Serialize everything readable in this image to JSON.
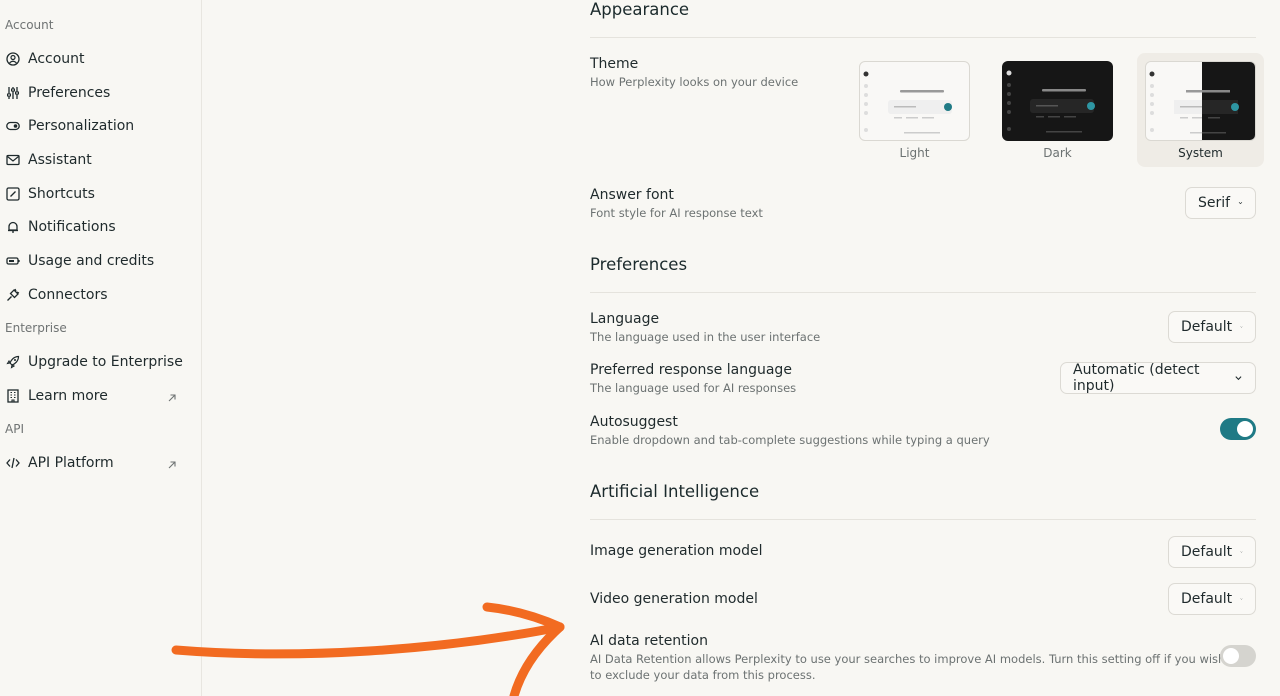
{
  "sidebar": {
    "groups": [
      {
        "heading": "Account"
      },
      {
        "heading": "Enterprise"
      },
      {
        "heading": "API"
      }
    ],
    "items": [
      {
        "label": "Account",
        "icon": "user-circle-icon"
      },
      {
        "label": "Preferences",
        "icon": "sliders-icon"
      },
      {
        "label": "Personalization",
        "icon": "toggle-icon"
      },
      {
        "label": "Assistant",
        "icon": "mail-icon"
      },
      {
        "label": "Shortcuts",
        "icon": "shortcut-icon"
      },
      {
        "label": "Notifications",
        "icon": "bell-icon"
      },
      {
        "label": "Usage and credits",
        "icon": "battery-icon"
      },
      {
        "label": "Connectors",
        "icon": "plug-icon"
      },
      {
        "label": "Upgrade to Enterprise",
        "icon": "rocket-icon"
      },
      {
        "label": "Learn more",
        "icon": "building-icon",
        "external": true
      },
      {
        "label": "API Platform",
        "icon": "code-icon",
        "external": true
      }
    ]
  },
  "appearance": {
    "title": "Appearance",
    "theme": {
      "title": "Theme",
      "desc": "How Perplexity looks on your device",
      "options": [
        {
          "label": "Light"
        },
        {
          "label": "Dark"
        },
        {
          "label": "System"
        }
      ],
      "selected": "System",
      "accent": "#1f7a85"
    },
    "answer_font": {
      "title": "Answer font",
      "desc": "Font style for AI response text",
      "value": "Serif"
    }
  },
  "preferences": {
    "title": "Preferences",
    "language": {
      "title": "Language",
      "desc": "The language used in the user interface",
      "value": "Default"
    },
    "response_language": {
      "title": "Preferred response language",
      "desc": "The language used for AI responses",
      "value": "Automatic (detect input)"
    },
    "autosuggest": {
      "title": "Autosuggest",
      "desc": "Enable dropdown and tab-complete suggestions while typing a query",
      "enabled": true
    }
  },
  "ai": {
    "title": "Artificial Intelligence",
    "image_model": {
      "title": "Image generation model",
      "value": "Default"
    },
    "video_model": {
      "title": "Video generation model",
      "value": "Default"
    },
    "retention": {
      "title": "AI data retention",
      "desc_line1": "AI Data Retention allows Perplexity to use your searches to improve AI models. Turn this setting off if you wish",
      "desc_line2": "to exclude your data from this process.",
      "enabled": false
    }
  },
  "annotation": {
    "color": "#f26b21"
  }
}
